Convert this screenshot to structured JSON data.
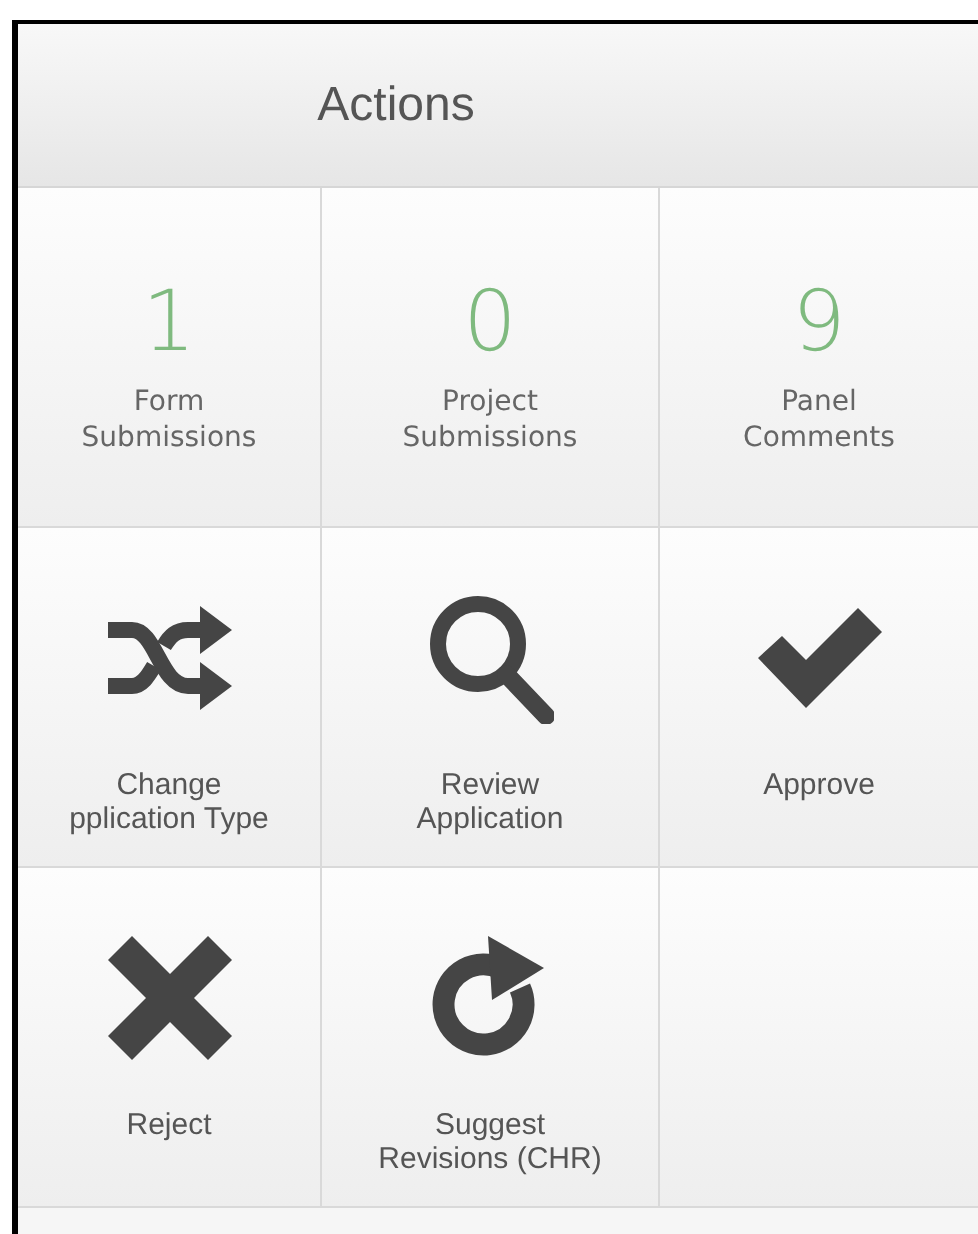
{
  "panel": {
    "title": "Actions"
  },
  "tiles": [
    {
      "kind": "counter",
      "count": "1",
      "label": "Form\nSubmissions"
    },
    {
      "kind": "counter",
      "count": "0",
      "label": "Project\nSubmissions"
    },
    {
      "kind": "counter",
      "count": "9",
      "label": "Panel\nComments"
    },
    {
      "kind": "shuffle",
      "label": "Change\npplication Type"
    },
    {
      "kind": "search",
      "label": "Review\nApplication"
    },
    {
      "kind": "check",
      "label": "Approve"
    },
    {
      "kind": "cross",
      "label": "Reject"
    },
    {
      "kind": "redo",
      "label": "Suggest\nRevisions (CHR)"
    }
  ]
}
